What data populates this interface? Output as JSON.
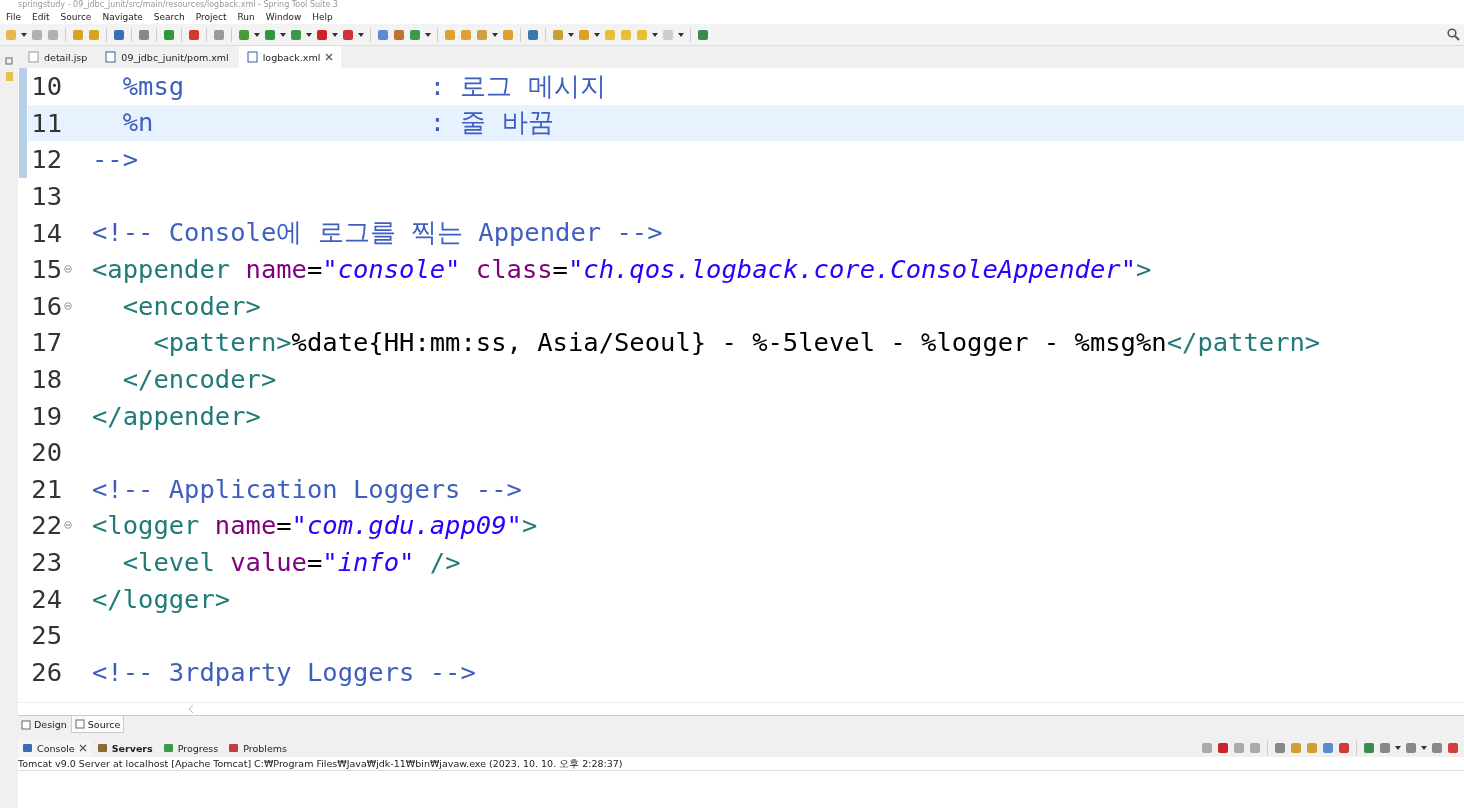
{
  "window": {
    "title": "springstudy - 09_jdbc_junit/src/main/resources/logback.xml - Spring Tool Suite 3"
  },
  "menu": [
    "File",
    "Edit",
    "Source",
    "Navigate",
    "Search",
    "Project",
    "Run",
    "Window",
    "Help"
  ],
  "editor_tabs": [
    {
      "label": "detail.jsp",
      "kind": "jsp",
      "selected": false
    },
    {
      "label": "09_jdbc_junit/pom.xml",
      "kind": "maven",
      "selected": false
    },
    {
      "label": "logback.xml",
      "kind": "xml",
      "selected": true
    }
  ],
  "lines": [
    {
      "number": "10",
      "foldable": false,
      "current": false,
      "segments": [
        {
          "kind": "comment",
          "text": "  %msg                : 로그 메시지"
        }
      ]
    },
    {
      "number": "11",
      "foldable": false,
      "current": true,
      "segments": [
        {
          "kind": "comment",
          "text": "  %n                  : 줄 바꿈"
        }
      ]
    },
    {
      "number": "12",
      "foldable": false,
      "current": false,
      "segments": [
        {
          "kind": "comment",
          "text": "-->"
        }
      ]
    },
    {
      "number": "13",
      "foldable": false,
      "current": false
    },
    {
      "number": "14",
      "foldable": false,
      "current": false,
      "segments": [
        {
          "kind": "comment",
          "text": "<!-- Console에 로그를 찍는 Appender -->"
        }
      ]
    },
    {
      "number": "15",
      "foldable": true,
      "current": false,
      "segments": [
        {
          "kind": "tag",
          "text": "<appender"
        },
        {
          "kind": "attr",
          "text": " name"
        },
        {
          "kind": "text",
          "text": "="
        },
        {
          "kind": "value",
          "text": "\"console\""
        },
        {
          "kind": "attr",
          "text": " class"
        },
        {
          "kind": "text",
          "text": "="
        },
        {
          "kind": "value",
          "text": "\"ch.qos.logback.core.ConsoleAppender\""
        },
        {
          "kind": "tag",
          "text": ">"
        }
      ]
    },
    {
      "number": "16",
      "foldable": true,
      "current": false,
      "segments": [
        {
          "kind": "tag",
          "text": "  <encoder>"
        }
      ]
    },
    {
      "number": "17",
      "foldable": false,
      "current": false,
      "segments": [
        {
          "kind": "tag",
          "text": "    <pattern>"
        },
        {
          "kind": "text",
          "text": "%date{HH:mm:ss, Asia/Seoul} - %-5level - %logger - %msg%n"
        },
        {
          "kind": "tag",
          "text": "</pattern>"
        }
      ]
    },
    {
      "number": "18",
      "foldable": false,
      "current": false,
      "segments": [
        {
          "kind": "tag",
          "text": "  </encoder>"
        }
      ]
    },
    {
      "number": "19",
      "foldable": false,
      "current": false,
      "segments": [
        {
          "kind": "tag",
          "text": "</appender>"
        }
      ]
    },
    {
      "number": "20",
      "foldable": false,
      "current": false
    },
    {
      "number": "21",
      "foldable": false,
      "current": false,
      "segments": [
        {
          "kind": "comment",
          "text": "<!-- Application Loggers -->"
        }
      ]
    },
    {
      "number": "22",
      "foldable": true,
      "current": false,
      "segments": [
        {
          "kind": "tag",
          "text": "<logger"
        },
        {
          "kind": "attr",
          "text": " name"
        },
        {
          "kind": "text",
          "text": "="
        },
        {
          "kind": "value",
          "text": "\"com.gdu.app09\""
        },
        {
          "kind": "tag",
          "text": ">"
        }
      ]
    },
    {
      "number": "23",
      "foldable": false,
      "current": false,
      "segments": [
        {
          "kind": "tag",
          "text": "  <level"
        },
        {
          "kind": "attr",
          "text": " value"
        },
        {
          "kind": "text",
          "text": "="
        },
        {
          "kind": "value",
          "text": "\"info\""
        },
        {
          "kind": "tag",
          "text": " />"
        }
      ]
    },
    {
      "number": "24",
      "foldable": false,
      "current": false,
      "segments": [
        {
          "kind": "tag",
          "text": "</logger>"
        }
      ]
    },
    {
      "number": "25",
      "foldable": false,
      "current": false
    },
    {
      "number": "26",
      "foldable": false,
      "current": false,
      "segments": [
        {
          "kind": "comment",
          "text": "<!-- 3rdparty Loggers -->"
        }
      ]
    }
  ],
  "view_tabs": [
    {
      "label": "Design",
      "selected": false
    },
    {
      "label": "Source",
      "selected": true
    }
  ],
  "console_tabs": [
    {
      "label": "Console",
      "kind": "console",
      "selected": true,
      "bold": false
    },
    {
      "label": "Servers",
      "kind": "servers",
      "selected": false,
      "bold": true
    },
    {
      "label": "Progress",
      "kind": "progress",
      "selected": false,
      "bold": false
    },
    {
      "label": "Problems",
      "kind": "problems",
      "selected": false,
      "bold": false
    }
  ],
  "console": {
    "description": "Tomcat v9.0 Server at localhost [Apache Tomcat] C:₩Program Files₩Java₩jdk-11₩bin₩javaw.exe  (2023. 10. 10. 오후 2:28:37)"
  }
}
